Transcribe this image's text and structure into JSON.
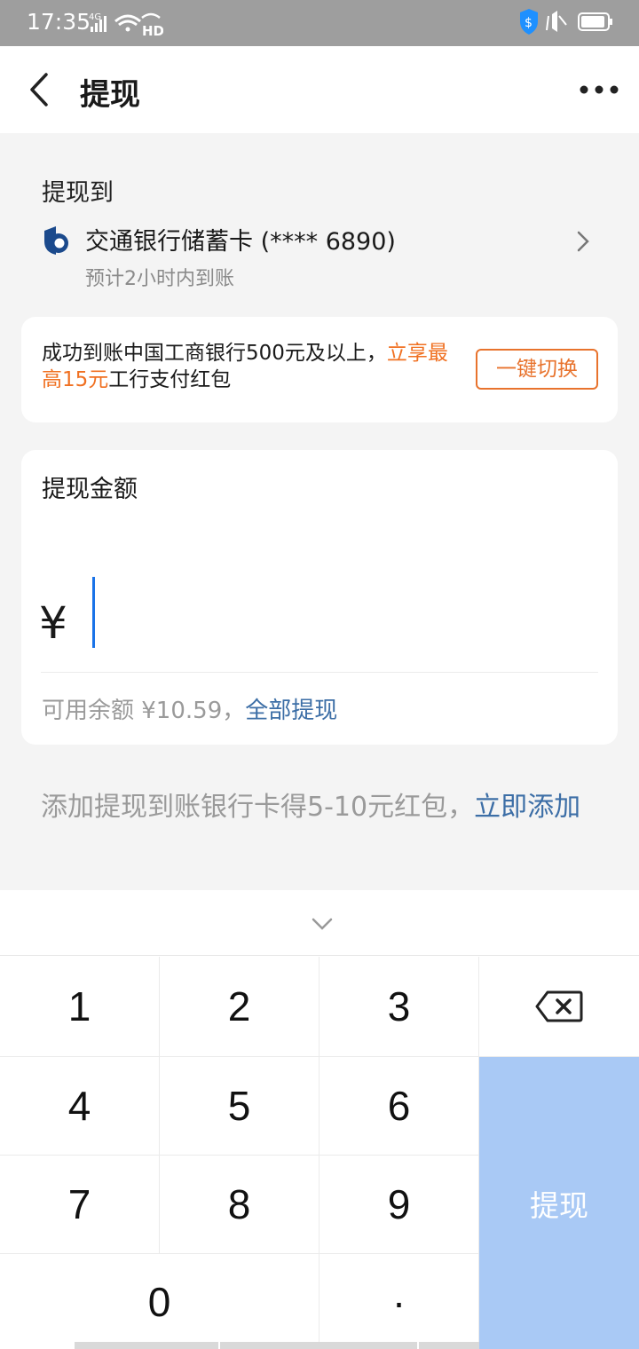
{
  "status": {
    "time": "17:35",
    "net": "4G",
    "hd": "HD"
  },
  "nav": {
    "title": "提现"
  },
  "destination": {
    "label": "提现到",
    "bank_name": "交通银行储蓄卡 (**** 6890)",
    "eta": "预计2小时内到账"
  },
  "promo": {
    "text_normal": "成功到账中国工商银行500元及以上，",
    "text_highlight": "立享最高15元",
    "text_tail": "工行支付红包",
    "button_label": "一键切换"
  },
  "amount": {
    "label": "提现金额",
    "currency": "¥",
    "value": "",
    "balance_prefix": "可用余额 ¥10.59，",
    "withdraw_all": "全部提现"
  },
  "add_card": {
    "text": "添加提现到账银行卡得5-10元红包，",
    "link": "立即添加"
  },
  "keyboard": {
    "keys": [
      "1",
      "2",
      "3",
      "4",
      "5",
      "6",
      "7",
      "8",
      "9",
      "0",
      "·"
    ],
    "submit_label": "提现"
  },
  "colors": {
    "accent": "#3c6ea6",
    "promo_orange": "#f07021",
    "submit_bg": "#a9c9f5",
    "caret": "#1a73e8"
  }
}
